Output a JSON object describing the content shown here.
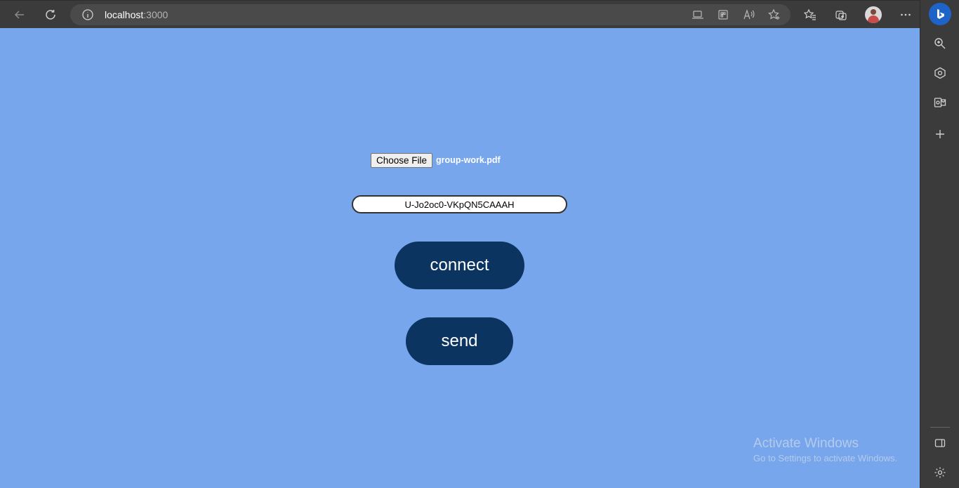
{
  "browser": {
    "address_bar": {
      "host": "localhost",
      "port": ":3000"
    }
  },
  "page": {
    "file_input": {
      "button_label": "Choose File",
      "file_name": "group-work.pdf"
    },
    "peer_id": {
      "value": "U-Jo2oc0-VKpQN5CAAAH"
    },
    "connect_label": "connect",
    "send_label": "send",
    "background_color": "#78a6ec",
    "button_color": "#0b3560"
  },
  "watermark": {
    "title": "Activate Windows",
    "subtitle": "Go to Settings to activate Windows."
  },
  "icons": {
    "toolbar": [
      "back-icon",
      "refresh-icon",
      "info-icon",
      "app-available-icon",
      "extensions-icon",
      "read-aloud-icon",
      "add-favorite-icon",
      "favorites-icon",
      "collections-icon",
      "more-icon"
    ],
    "sidebar": [
      "bing-icon",
      "search-icon",
      "shopping-icon",
      "outlook-icon",
      "add-icon",
      "hide-sidebar-icon",
      "settings-icon"
    ]
  }
}
